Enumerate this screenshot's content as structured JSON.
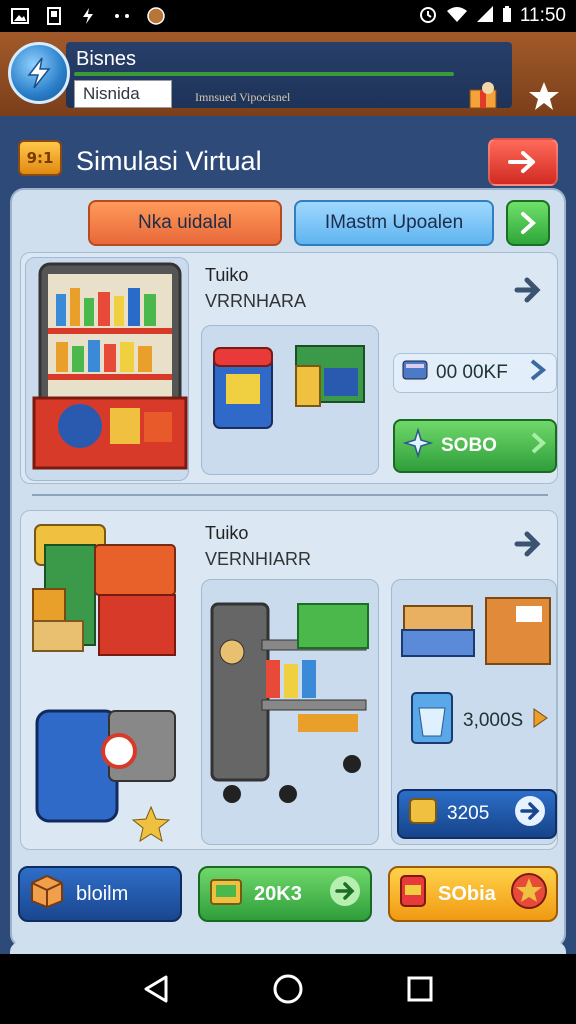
{
  "status_bar": {
    "time": "11:50"
  },
  "header": {
    "brand": "Bisnes",
    "name_box": "Nisnida",
    "subtitle": "Imnsued Vipocisnel"
  },
  "title_bar": {
    "icon_text": "9:1",
    "title": "Simulasi Virtual"
  },
  "tabs": {
    "orange": "Nka uidalal",
    "blue": "IMastm Upoalen"
  },
  "section1": {
    "title": "Tuiko",
    "subtitle": "VRRNHARA",
    "counter": "00 00KF",
    "action": "SOBO"
  },
  "section2": {
    "title": "Tuiko",
    "subtitle": "VERNHIARR",
    "price": "3,000S",
    "action": "3205"
  },
  "bottom_buttons": {
    "left": "bloilm",
    "middle": "20K3",
    "right": "SObia"
  },
  "colors": {
    "accent_green": "#2f9e3a",
    "accent_blue": "#1a4690",
    "accent_orange": "#e8683a",
    "accent_red": "#d12a22",
    "panel": "#cfdfee"
  }
}
